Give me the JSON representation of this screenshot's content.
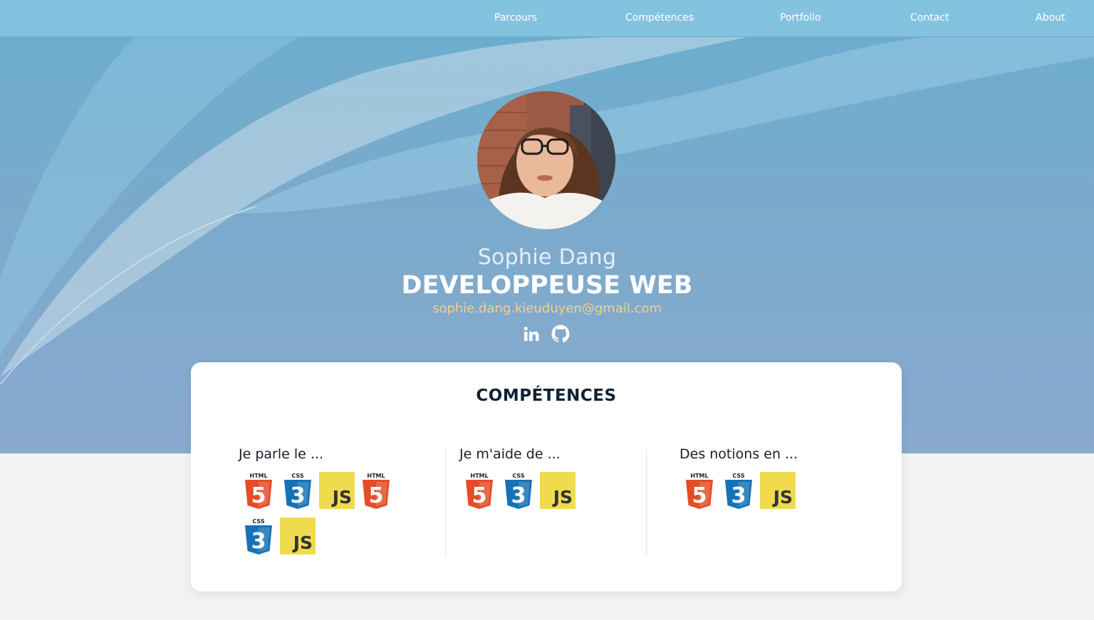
{
  "nav": {
    "items": [
      {
        "label": "Parcours"
      },
      {
        "label": "Compétences"
      },
      {
        "label": "Portfolio"
      },
      {
        "label": "Contact"
      },
      {
        "label": "About"
      }
    ]
  },
  "profile": {
    "name": "Sophie Dang",
    "role": "DEVELOPPEUSE WEB",
    "email": "sophie.dang.kieuduyen@gmail.com",
    "socials": [
      {
        "icon": "linkedin-icon"
      },
      {
        "icon": "github-icon"
      }
    ]
  },
  "skills": {
    "title": "COMPÉTENCES",
    "columns": [
      {
        "title": "Je parle le ...",
        "logos": [
          "html5",
          "css3",
          "js",
          "html5",
          "css3",
          "js"
        ]
      },
      {
        "title": "Je m'aide de ...",
        "logos": [
          "html5",
          "css3",
          "js"
        ]
      },
      {
        "title": "Des notions en ...",
        "logos": [
          "html5",
          "css3",
          "js"
        ]
      }
    ]
  },
  "logo_text": {
    "html": "HTML",
    "html_num": "5",
    "css": "CSS",
    "css_num": "3",
    "js": "JS"
  },
  "colors": {
    "nav_bg": "#84c3df",
    "email": "#f2cf8e",
    "html5": "#e44d26",
    "css3": "#1572b6",
    "js": "#f0db4f"
  }
}
